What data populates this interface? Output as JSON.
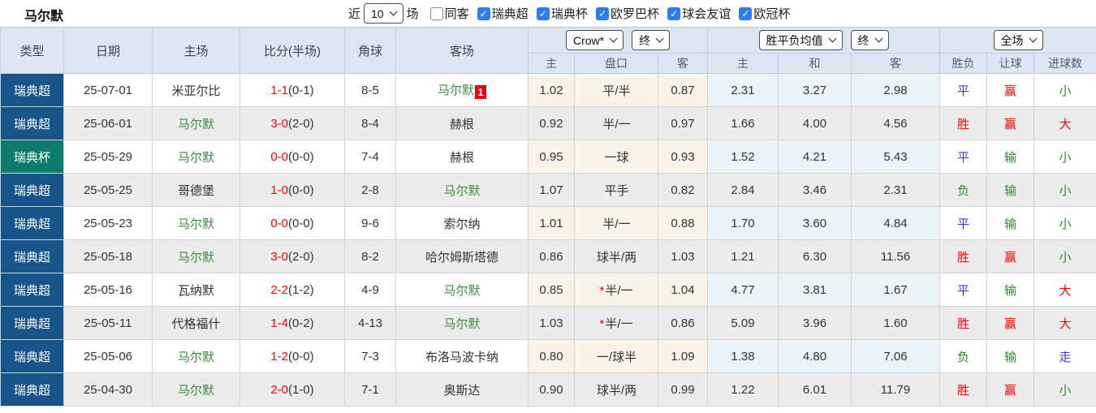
{
  "title": "马尔默",
  "filters": {
    "recent_label": "近",
    "recent_value": "10",
    "unit_label": "场",
    "same_venue": {
      "label": "同客",
      "checked": false
    },
    "leagues": [
      {
        "label": "瑞典超",
        "checked": true
      },
      {
        "label": "瑞典杯",
        "checked": true
      },
      {
        "label": "欧罗巴杯",
        "checked": true
      },
      {
        "label": "球会友谊",
        "checked": true
      },
      {
        "label": "欧冠杯",
        "checked": true
      }
    ]
  },
  "table": {
    "left_columns": [
      "类型",
      "日期",
      "主场",
      "比分(半场)",
      "角球",
      "客场"
    ],
    "groups": {
      "handicap": {
        "selects": [
          "Crow*",
          "终"
        ],
        "sub_columns": [
          "主",
          "盘口",
          "客"
        ]
      },
      "win_draw_loss": {
        "selects": [
          "胜平负均值",
          "终"
        ],
        "sub_columns": [
          "主",
          "和",
          "客"
        ]
      },
      "result": {
        "selects": [
          "全场"
        ],
        "sub_columns": [
          "胜负",
          "让球",
          "进球数"
        ]
      }
    },
    "rows": [
      {
        "type": "瑞典超",
        "type_class": "navy",
        "date": "25-07-01",
        "home": "米亚尔比",
        "home_class": "",
        "score": "1-1",
        "half": "(0-1)",
        "corner": "8-5",
        "away": "马尔默",
        "away_class": "self",
        "away_badge": "1",
        "ah_home": "1.02",
        "handicap_star": "",
        "handicap": "平/半",
        "ah_away": "0.87",
        "avg_home": "2.31",
        "avg_draw": "3.27",
        "avg_away": "2.98",
        "wdl": "平",
        "wdl_class": "blue",
        "ah_result": "赢",
        "ah_result_class": "red",
        "ou": "小",
        "ou_class": "green"
      },
      {
        "type": "瑞典超",
        "type_class": "navy",
        "date": "25-06-01",
        "home": "马尔默",
        "home_class": "self",
        "score": "3-0",
        "half": "(2-0)",
        "corner": "8-4",
        "away": "赫根",
        "away_class": "",
        "away_badge": "",
        "ah_home": "0.92",
        "handicap_star": "",
        "handicap": "半/一",
        "ah_away": "0.97",
        "avg_home": "1.66",
        "avg_draw": "4.00",
        "avg_away": "4.56",
        "wdl": "胜",
        "wdl_class": "red",
        "ah_result": "赢",
        "ah_result_class": "red",
        "ou": "大",
        "ou_class": "red"
      },
      {
        "type": "瑞典杯",
        "type_class": "teal",
        "date": "25-05-29",
        "home": "马尔默",
        "home_class": "self",
        "score": "0-0",
        "half": "(0-0)",
        "corner": "7-4",
        "away": "赫根",
        "away_class": "",
        "away_badge": "",
        "ah_home": "0.95",
        "handicap_star": "",
        "handicap": "一球",
        "ah_away": "0.93",
        "avg_home": "1.52",
        "avg_draw": "4.21",
        "avg_away": "5.43",
        "wdl": "平",
        "wdl_class": "blue",
        "ah_result": "输",
        "ah_result_class": "green",
        "ou": "小",
        "ou_class": "green"
      },
      {
        "type": "瑞典超",
        "type_class": "navy",
        "date": "25-05-25",
        "home": "哥德堡",
        "home_class": "",
        "score": "1-0",
        "half": "(0-0)",
        "corner": "2-8",
        "away": "马尔默",
        "away_class": "self",
        "away_badge": "",
        "ah_home": "1.07",
        "handicap_star": "",
        "handicap": "平手",
        "ah_away": "0.82",
        "avg_home": "2.84",
        "avg_draw": "3.46",
        "avg_away": "2.31",
        "wdl": "负",
        "wdl_class": "green",
        "ah_result": "输",
        "ah_result_class": "green",
        "ou": "小",
        "ou_class": "green"
      },
      {
        "type": "瑞典超",
        "type_class": "navy",
        "date": "25-05-23",
        "home": "马尔默",
        "home_class": "self",
        "score": "0-0",
        "half": "(0-0)",
        "corner": "9-6",
        "away": "索尔纳",
        "away_class": "",
        "away_badge": "",
        "ah_home": "1.01",
        "handicap_star": "",
        "handicap": "半/一",
        "ah_away": "0.88",
        "avg_home": "1.70",
        "avg_draw": "3.60",
        "avg_away": "4.84",
        "wdl": "平",
        "wdl_class": "blue",
        "ah_result": "输",
        "ah_result_class": "green",
        "ou": "小",
        "ou_class": "green"
      },
      {
        "type": "瑞典超",
        "type_class": "navy",
        "date": "25-05-18",
        "home": "马尔默",
        "home_class": "self",
        "score": "3-0",
        "half": "(2-0)",
        "corner": "8-2",
        "away": "哈尔姆斯塔德",
        "away_class": "",
        "away_badge": "",
        "ah_home": "0.86",
        "handicap_star": "",
        "handicap": "球半/两",
        "ah_away": "1.03",
        "avg_home": "1.21",
        "avg_draw": "6.30",
        "avg_away": "11.56",
        "wdl": "胜",
        "wdl_class": "red",
        "ah_result": "赢",
        "ah_result_class": "red",
        "ou": "小",
        "ou_class": "green"
      },
      {
        "type": "瑞典超",
        "type_class": "navy",
        "date": "25-05-16",
        "home": "瓦纳默",
        "home_class": "",
        "score": "2-2",
        "half": "(1-2)",
        "corner": "4-9",
        "away": "马尔默",
        "away_class": "self",
        "away_badge": "",
        "ah_home": "0.85",
        "handicap_star": "*",
        "handicap": "半/一",
        "ah_away": "1.04",
        "avg_home": "4.77",
        "avg_draw": "3.81",
        "avg_away": "1.67",
        "wdl": "平",
        "wdl_class": "blue",
        "ah_result": "输",
        "ah_result_class": "green",
        "ou": "大",
        "ou_class": "red"
      },
      {
        "type": "瑞典超",
        "type_class": "navy",
        "date": "25-05-11",
        "home": "代格福什",
        "home_class": "",
        "score": "1-4",
        "half": "(0-2)",
        "corner": "4-13",
        "away": "马尔默",
        "away_class": "self",
        "away_badge": "",
        "ah_home": "1.03",
        "handicap_star": "*",
        "handicap": "半/一",
        "ah_away": "0.86",
        "avg_home": "5.09",
        "avg_draw": "3.96",
        "avg_away": "1.60",
        "wdl": "胜",
        "wdl_class": "red",
        "ah_result": "赢",
        "ah_result_class": "red",
        "ou": "大",
        "ou_class": "red"
      },
      {
        "type": "瑞典超",
        "type_class": "navy",
        "date": "25-05-06",
        "home": "马尔默",
        "home_class": "self",
        "score": "1-2",
        "half": "(0-0)",
        "corner": "7-3",
        "away": "布洛马波卡纳",
        "away_class": "",
        "away_badge": "",
        "ah_home": "0.80",
        "handicap_star": "",
        "handicap": "一/球半",
        "ah_away": "1.09",
        "avg_home": "1.38",
        "avg_draw": "4.80",
        "avg_away": "7.06",
        "wdl": "负",
        "wdl_class": "green",
        "ah_result": "输",
        "ah_result_class": "green",
        "ou": "走",
        "ou_class": "blue"
      },
      {
        "type": "瑞典超",
        "type_class": "navy",
        "date": "25-04-30",
        "home": "马尔默",
        "home_class": "self",
        "score": "2-0",
        "half": "(1-0)",
        "corner": "7-1",
        "away": "奥斯达",
        "away_class": "",
        "away_badge": "",
        "ah_home": "0.90",
        "handicap_star": "",
        "handicap": "球半/两",
        "ah_away": "0.99",
        "avg_home": "1.22",
        "avg_draw": "6.01",
        "avg_away": "11.79",
        "wdl": "胜",
        "wdl_class": "red",
        "ah_result": "赢",
        "ah_result_class": "red",
        "ou": "小",
        "ou_class": "green"
      }
    ]
  },
  "colors": {
    "league_swe_super_bg": "#17548a",
    "league_swe_cup_bg": "#0e7c6b",
    "win_red": "#ff0000",
    "draw_blue": "#3b3be6",
    "lose_green": "#2f8a2f",
    "self_team_green": "#3d8b3d",
    "badge_red": "#e8000d",
    "handicap_col_bg": "#faf4e8",
    "avg_odds_col_bg": "#eaf3f8",
    "header_bg": "#dce6f1",
    "checkbox_blue": "#2e7df0"
  }
}
